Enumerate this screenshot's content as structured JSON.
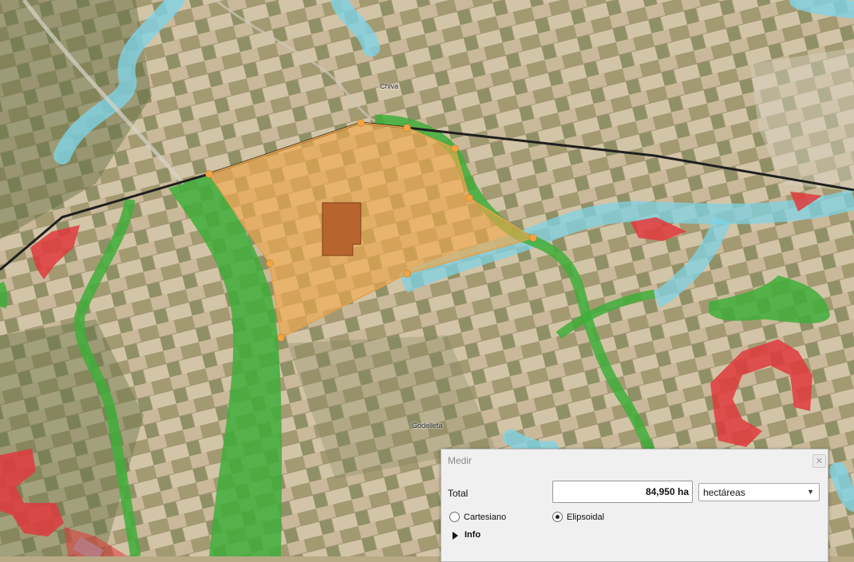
{
  "map": {
    "place_labels": {
      "chiva": "Chiva",
      "godelleta": "Godelleta"
    },
    "colors": {
      "terrain": "#b9aa86",
      "river_zone": "#7fd3e6",
      "green_corridor": "#3fae3a",
      "red_zone": "#e0393d",
      "measured_polygon": "#f3a84a",
      "inner_parcel": "#b8642e",
      "road": "#222222"
    }
  },
  "measure_dialog": {
    "title": "Medir",
    "close_icon": "close-icon",
    "total_label": "Total",
    "total_value": "84,950 ha",
    "unit_selected": "hectáreas",
    "options": {
      "cartesian": "Cartesiano",
      "ellipsoidal": "Elipsoidal"
    },
    "selected_option": "Elipsoidal",
    "info_label": "Info"
  }
}
